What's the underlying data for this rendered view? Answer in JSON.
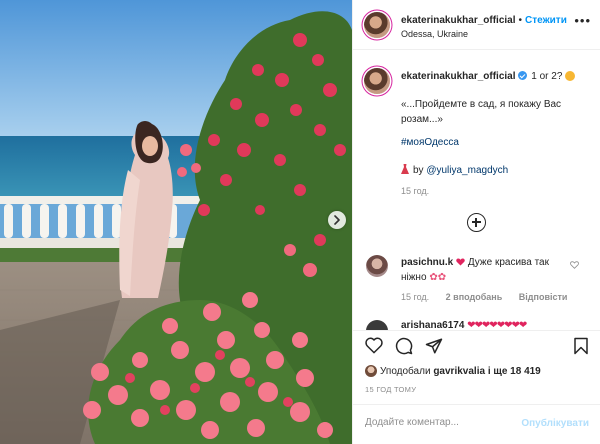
{
  "post": {
    "author": "ekaterinakukhar_official",
    "follow_label": "Стежити",
    "location": "Odessa, Ukraine",
    "more_label": "•••"
  },
  "caption": {
    "user": "ekaterinakukhar_official",
    "first_line": "1 or 2?",
    "text": "«...Пройдемте в сад, я покажу Вас розам...»",
    "hashtag": "#мояОдесса",
    "credit_prefix": "by",
    "credit_user": "@yuliya_magdych",
    "time": "15 год."
  },
  "comments": [
    {
      "user": "pasichnu.k",
      "text": "Дуже красива так ніжно",
      "time": "15 год.",
      "likes": "2 вподобань",
      "reply": "Відповісти"
    },
    {
      "user": "arishana6174",
      "text": ""
    }
  ],
  "engagement": {
    "liked_by_prefix": "Уподобали",
    "liked_by_user": "gavrikvalia",
    "liked_by_suffix": "і ще 18 419",
    "date": "15 ГОД ТОМУ"
  },
  "composer": {
    "placeholder": "Додайте коментар...",
    "publish_label": "Опублікувати"
  },
  "icons": [
    "heart-icon",
    "comment-icon",
    "share-icon",
    "bookmark-icon",
    "next-icon",
    "plus-circle-icon",
    "verified-icon"
  ],
  "colors": {
    "link": "#0095f6",
    "hashtag": "#00376b",
    "muted": "#8e8e8e",
    "like": "#ed4956"
  }
}
